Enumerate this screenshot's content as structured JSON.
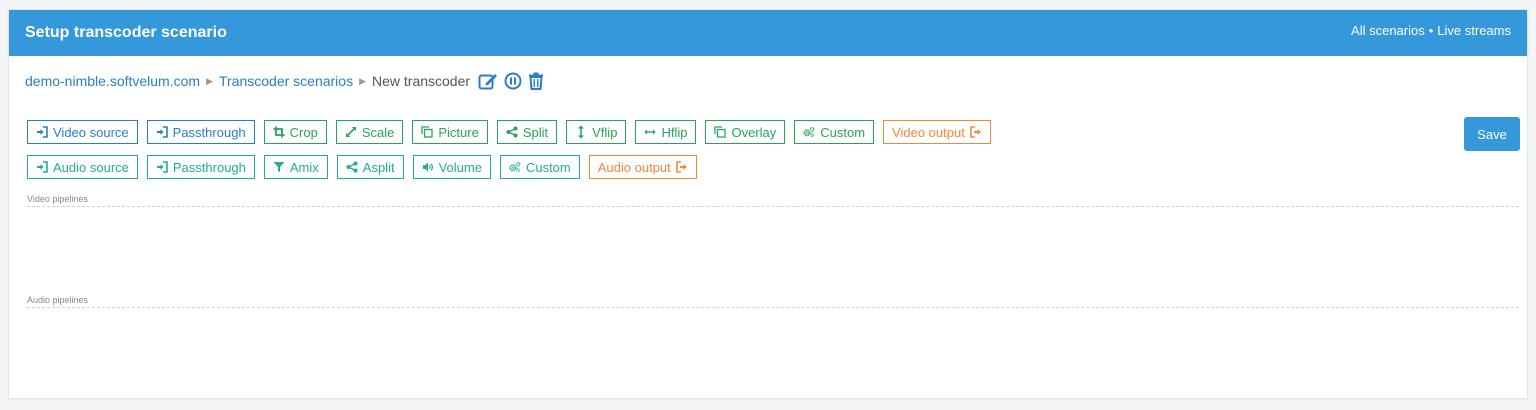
{
  "header": {
    "title": "Setup transcoder scenario",
    "all_scenarios": "All scenarios",
    "separator": "•",
    "live_streams": "Live streams"
  },
  "breadcrumb": {
    "server": "demo-nimble.softvelum.com",
    "scenarios": "Transcoder scenarios",
    "current": "New transcoder"
  },
  "video_toolbar": [
    {
      "label": "Video source",
      "icon": "sign-in-icon",
      "style": "blue"
    },
    {
      "label": "Passthrough",
      "icon": "sign-in-icon",
      "style": "blue"
    },
    {
      "label": "Crop",
      "icon": "crop-icon",
      "style": "green"
    },
    {
      "label": "Scale",
      "icon": "expand-icon",
      "style": "green"
    },
    {
      "label": "Picture",
      "icon": "copy-icon",
      "style": "green"
    },
    {
      "label": "Split",
      "icon": "share-icon",
      "style": "green"
    },
    {
      "label": "Vflip",
      "icon": "vertical-arrows-icon",
      "style": "green"
    },
    {
      "label": "Hflip",
      "icon": "horizontal-arrows-icon",
      "style": "green"
    },
    {
      "label": "Overlay",
      "icon": "copy-icon",
      "style": "green"
    },
    {
      "label": "Custom",
      "icon": "gears-icon",
      "style": "green"
    },
    {
      "label": "Video output",
      "icon": "sign-out-icon",
      "style": "orange"
    }
  ],
  "audio_toolbar": [
    {
      "label": "Audio source",
      "icon": "sign-in-icon",
      "style": "teal"
    },
    {
      "label": "Passthrough",
      "icon": "sign-in-icon",
      "style": "teal"
    },
    {
      "label": "Amix",
      "icon": "filter-icon",
      "style": "teal"
    },
    {
      "label": "Asplit",
      "icon": "share-icon",
      "style": "teal"
    },
    {
      "label": "Volume",
      "icon": "volume-icon",
      "style": "teal"
    },
    {
      "label": "Custom",
      "icon": "gears-icon",
      "style": "teal"
    },
    {
      "label": "Audio output",
      "icon": "sign-out-icon",
      "style": "orange"
    }
  ],
  "save_label": "Save",
  "sections": {
    "video": "Video pipelines",
    "audio": "Audio pipelines"
  },
  "colors": {
    "header": "#3498db",
    "link": "#2a7ec3",
    "green": "#29a35a",
    "teal": "#1fae9a",
    "orange": "#f0883a"
  }
}
